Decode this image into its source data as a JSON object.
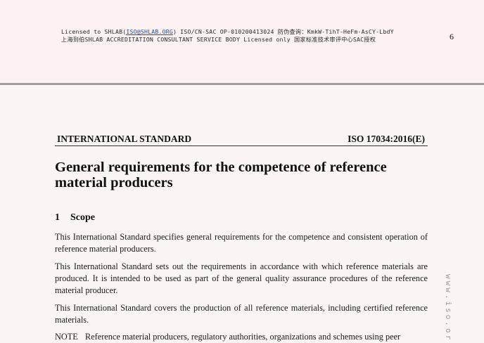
{
  "license": {
    "line1_prefix": "Licensed to SHLAB(",
    "line1_link": "ISO@SHLAB.ORG",
    "line1_suffix": ") ISO/CN-SAC OP-010200413024 防伪查询：KmkW-TihT-HeFm-AsCY-LbdY",
    "line2": "上海到伯SHLAB ACCREDITATION CONSULTANT SERVICE BODY Licensed only 国家标准技术审评中心SAC授权"
  },
  "page_number": "6",
  "header": {
    "left": "INTERNATIONAL STANDARD",
    "right": "ISO 17034:2016(E)"
  },
  "title": "General requirements for the competence of reference material producers",
  "section": {
    "number": "1",
    "heading": "Scope"
  },
  "paragraphs": [
    "This International Standard specifies general requirements for the competence and consistent operation of reference material producers.",
    "This International Standard sets out the requirements in accordance with which reference materials are produced. It is intended to be used as part of the general quality assurance procedures of the reference material producer.",
    "This International Standard covers the production of all reference materials, including certified reference materials."
  ],
  "note": {
    "label": "NOTE",
    "text": "Reference material producers, regulatory authorities, organizations and schemes using peer"
  },
  "watermark": "www.iso.org"
}
